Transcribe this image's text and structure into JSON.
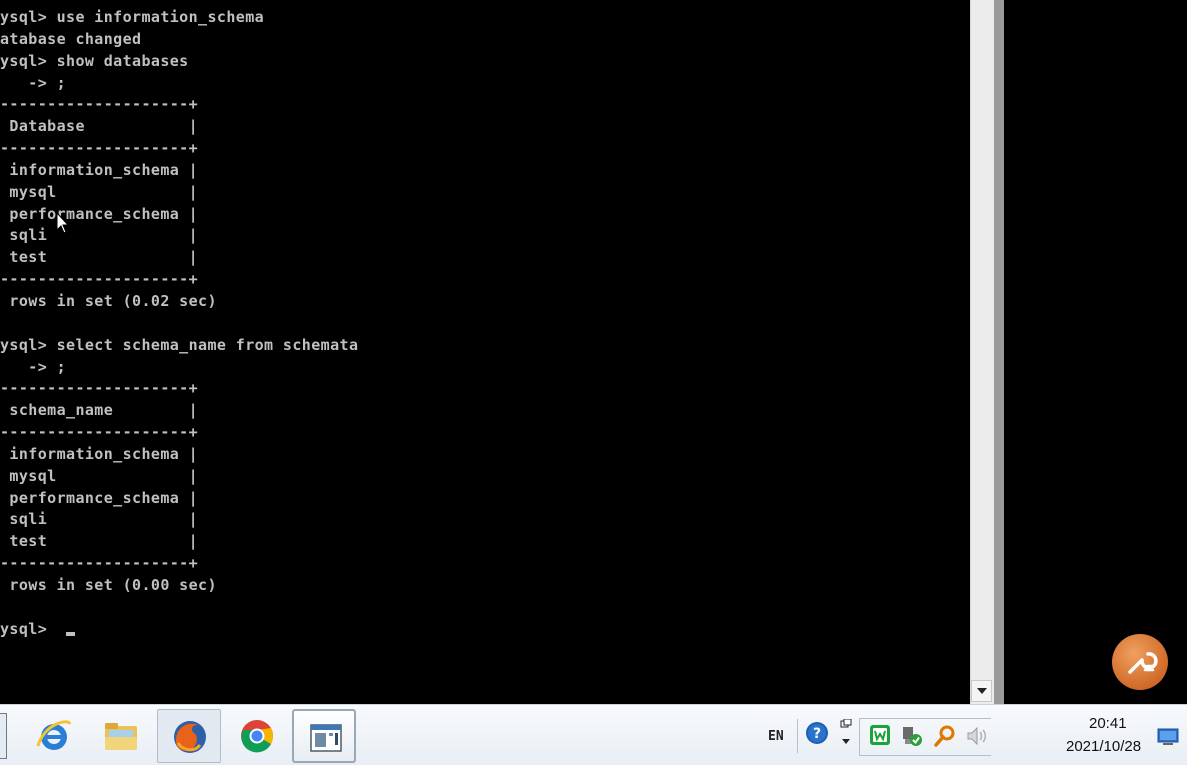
{
  "console": {
    "lines": [
      "ysql> use information_schema",
      "atabase changed",
      "ysql> show databases",
      "   -> ;",
      "--------------------+",
      " Database           |",
      "--------------------+",
      " information_schema |",
      " mysql              |",
      " performance_schema |",
      " sqli               |",
      " test               |",
      "--------------------+",
      " rows in set (0.02 sec)",
      "",
      "ysql> select schema_name from schemata",
      "   -> ;",
      "--------------------+",
      " schema_name        |",
      "--------------------+",
      " information_schema |",
      " mysql              |",
      " performance_schema |",
      " sqli               |",
      " test               |",
      "--------------------+",
      " rows in set (0.00 sec)",
      "",
      "ysql> "
    ]
  },
  "taskbar": {
    "pinned": [
      {
        "name": "internet-explorer",
        "icon": "ie-icon"
      },
      {
        "name": "file-explorer",
        "icon": "folder-icon"
      },
      {
        "name": "firefox",
        "icon": "firefox-icon"
      },
      {
        "name": "chrome",
        "icon": "chrome-icon"
      },
      {
        "name": "command-window",
        "icon": "console-window-icon"
      }
    ]
  },
  "tray": {
    "language": "EN",
    "icons": [
      "help-icon",
      "tray-overflow-icon",
      "green-w-icon",
      "network-device-icon",
      "search-key-icon",
      "volume-icon"
    ]
  },
  "clock": {
    "time": "20:41",
    "date": "2021/10/28"
  },
  "colors": {
    "console_bg": "#000000",
    "console_fg": "#c0c0c0",
    "tool_button": "#d06a28"
  }
}
